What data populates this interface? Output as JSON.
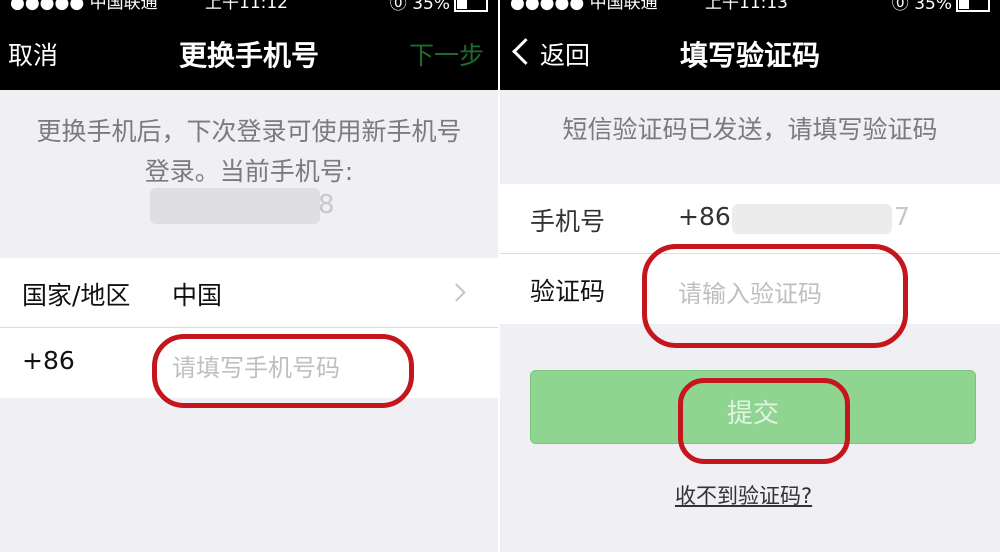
{
  "left": {
    "status": {
      "carrier": "●●●●● 中国联通 ⌃",
      "time": "上午11:12",
      "battery": "⓪ 35%"
    },
    "nav": {
      "cancel": "取消",
      "title": "更换手机号",
      "next": "下一步"
    },
    "description": "更换手机后，下次登录可使用新手机号登录。当前手机号:",
    "current_number_tail": "8",
    "country_label": "国家/地区",
    "country_value": "中国",
    "code": "+86",
    "phone_placeholder": "请填写手机号码"
  },
  "right": {
    "status": {
      "carrier": "●●●●● 中国联通 ⌃",
      "time": "上午11:13",
      "battery": "⓪ 35%"
    },
    "nav": {
      "back": "返回",
      "title": "填写验证码"
    },
    "description": "短信验证码已发送，请填写验证码",
    "phone_label": "手机号",
    "phone_value": "+86",
    "phone_tail": "7",
    "code_label": "验证码",
    "code_placeholder": "请输入验证码",
    "submit": "提交",
    "no_code_link": "收不到验证码?"
  },
  "colors": {
    "accent_red": "#c4161c",
    "button_green": "#8fd490",
    "nav_bg": "#000000"
  }
}
